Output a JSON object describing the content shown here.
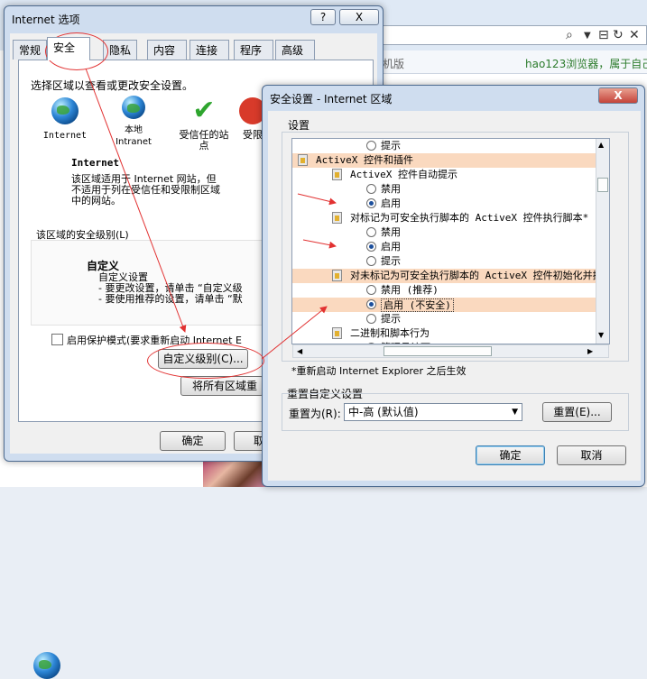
{
  "browser": {
    "edition_text": "机版",
    "tab_text": "hao123浏览器，属于自己"
  },
  "internet_options": {
    "title": "Internet 选项",
    "help": "?",
    "close": "X",
    "tabs": [
      "常规",
      "安全",
      "隐私",
      "内容",
      "连接",
      "程序",
      "高级"
    ],
    "select_zone_label": "选择区域以查看或更改安全设置。",
    "zones": [
      {
        "label": "Internet",
        "icon": "globe-icon"
      },
      {
        "label": "本地\nIntranet",
        "icon": "intranet-icon"
      },
      {
        "label": "受信任的站\n点",
        "icon": "check-icon"
      },
      {
        "label": "受限",
        "icon": "restricted-icon"
      }
    ],
    "zone_title": "Internet",
    "zone_desc": "该区域适用于 Internet 网站，但\n不适用于列在受信任和受限制区域\n中的网站。",
    "security_level_label": "该区域的安全级别(L)",
    "custom_title": "自定义",
    "custom_lines": [
      "自定义设置",
      "- 要更改设置，请单击 “自定义级",
      "- 要使用推荐的设置，请单击 “默"
    ],
    "protected_mode": "启用保护模式(要求重新启动 Internet E",
    "custom_level_button": "自定义级别(C)...",
    "reset_all_button": "将所有区域重",
    "ok_button": "确定",
    "cancel_button": "取"
  },
  "security_settings": {
    "title": "安全设置 - Internet 区域",
    "close": "X",
    "settings_label": "设置",
    "tree": [
      {
        "type": "radio",
        "label": "提示",
        "checked": false,
        "indent": 2,
        "hl": false
      },
      {
        "type": "section",
        "label": "ActiveX 控件和插件",
        "indent": 0,
        "hl": true
      },
      {
        "type": "item",
        "label": "ActiveX 控件自动提示",
        "indent": 1,
        "hl": false
      },
      {
        "type": "radio",
        "label": "禁用",
        "checked": false,
        "indent": 2,
        "hl": false
      },
      {
        "type": "radio",
        "label": "启用",
        "checked": true,
        "indent": 2,
        "hl": false
      },
      {
        "type": "item",
        "label": "对标记为可安全执行脚本的 ActiveX 控件执行脚本*",
        "indent": 1,
        "hl": false
      },
      {
        "type": "radio",
        "label": "禁用",
        "checked": false,
        "indent": 2,
        "hl": false
      },
      {
        "type": "radio",
        "label": "启用",
        "checked": true,
        "indent": 2,
        "hl": false
      },
      {
        "type": "radio",
        "label": "提示",
        "checked": false,
        "indent": 2,
        "hl": false
      },
      {
        "type": "item",
        "label": "对未标记为可安全执行脚本的 ActiveX 控件初始化并执",
        "indent": 1,
        "hl": true
      },
      {
        "type": "radio",
        "label": "禁用 (推荐)",
        "checked": false,
        "indent": 2,
        "hl": false
      },
      {
        "type": "radio",
        "label": "启用 (不安全)",
        "checked": true,
        "indent": 2,
        "hl": true,
        "selected": true
      },
      {
        "type": "radio",
        "label": "提示",
        "checked": false,
        "indent": 2,
        "hl": false
      },
      {
        "type": "item",
        "label": "二进制和脚本行为",
        "indent": 1,
        "hl": false
      },
      {
        "type": "radio",
        "label": "管理员认可",
        "checked": false,
        "indent": 2,
        "hl": false
      }
    ],
    "restart_note": "*重新启动 Internet Explorer 之后生效",
    "reset_custom_label": "重置自定义设置",
    "reset_to_label": "重置为(R):",
    "reset_to_value": "中-高 (默认值)",
    "reset_button": "重置(E)...",
    "ok_button": "确定",
    "cancel_button": "取消"
  }
}
